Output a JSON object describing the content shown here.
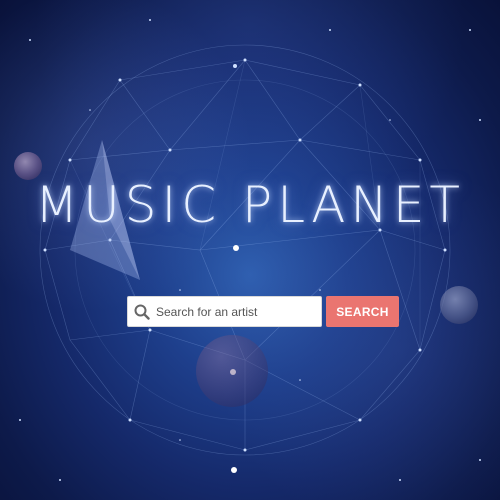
{
  "header": {
    "title": "MUSIC PLANET"
  },
  "search": {
    "placeholder": "Search for an artist",
    "value": "",
    "button_label": "SEARCH",
    "icon": "search-icon"
  },
  "colors": {
    "background": "#15296a",
    "accent": "#ea7570",
    "title": "#e8f0ff"
  }
}
